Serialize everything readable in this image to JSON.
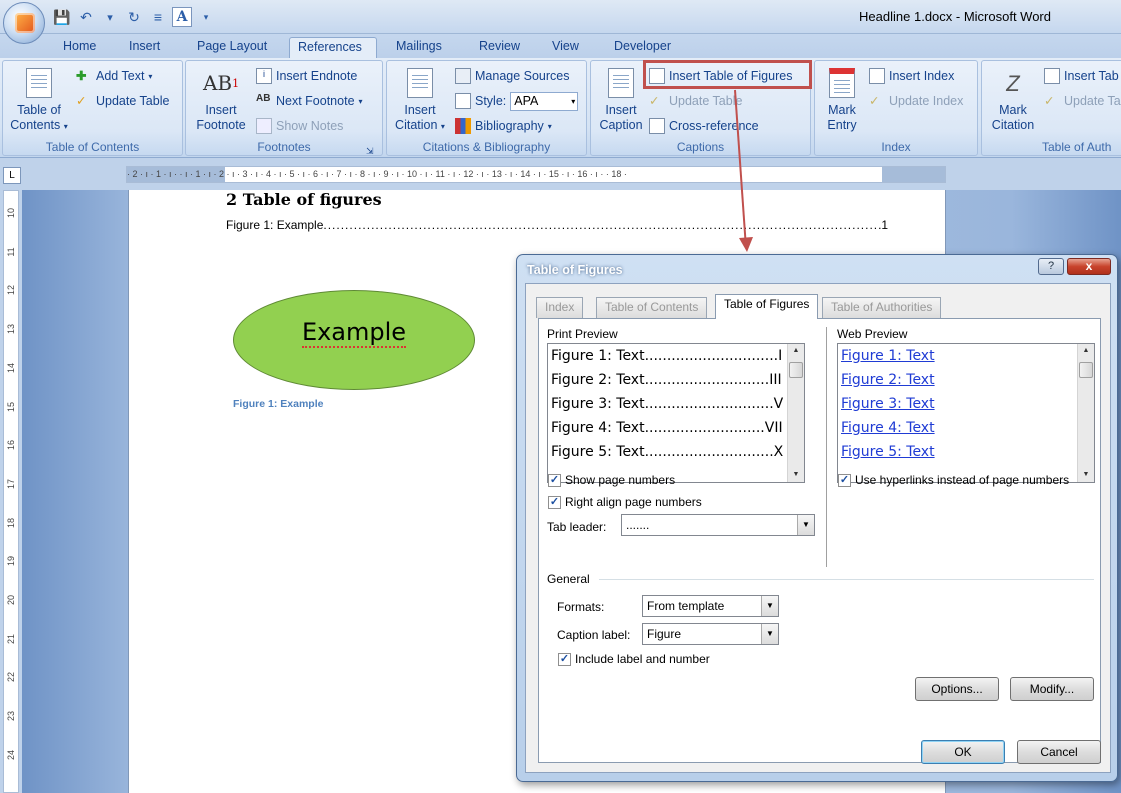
{
  "window": {
    "title": "Headline 1.docx - Microsoft Word"
  },
  "qat": {
    "icons": [
      "save-icon",
      "undo-icon",
      "redo-icon",
      "format-icon",
      "spelling-icon",
      "customize-icon"
    ]
  },
  "tabs": [
    "Home",
    "Insert",
    "Page Layout",
    "References",
    "Mailings",
    "Review",
    "View",
    "Developer"
  ],
  "active_tab": "References",
  "ribbon": {
    "toc": {
      "big_line1": "Table of",
      "big_line2": "Contents",
      "add_text": "Add Text",
      "update_table": "Update Table",
      "label": "Table of Contents"
    },
    "footnotes": {
      "big_line1": "Insert",
      "big_line2": "Footnote",
      "insert_endnote": "Insert Endnote",
      "next_footnote": "Next Footnote",
      "show_notes": "Show Notes",
      "label": "Footnotes",
      "icon_text": "AB"
    },
    "citations": {
      "big_line1": "Insert",
      "big_line2": "Citation",
      "manage_sources": "Manage Sources",
      "style_label": "Style:",
      "style_value": "APA",
      "bibliography": "Bibliography",
      "label": "Citations & Bibliography"
    },
    "captions": {
      "big_line1": "Insert",
      "big_line2": "Caption",
      "insert_tof": "Insert Table of Figures",
      "update_table": "Update Table",
      "cross_reference": "Cross-reference",
      "label": "Captions"
    },
    "index": {
      "big_line1": "Mark",
      "big_line2": "Entry",
      "insert_index": "Insert Index",
      "update_index": "Update Index",
      "label": "Index"
    },
    "authorities": {
      "big_line1": "Mark",
      "big_line2": "Citation",
      "insert_table": "Insert Tab",
      "update_table": "Update Ta",
      "label": "Table of Auth"
    }
  },
  "ruler": {
    "corner": "L",
    "text": "· 2 · ı · 1 · ı ·   · ı · 1 · ı · 2 · ı · 3 · ı · 4 · ı · 5 · ı · 6 · ı · 7 · ı · 8 · ı · 9 · ı · 10 · ı · 11 · ı · 12 · ı · 13 · ı · 14 · ı · 15 · ı · 16 · ı ·   · 18 ·",
    "vertical": [
      "10",
      "11",
      "12",
      "13",
      "14",
      "15",
      "16",
      "17",
      "18",
      "19",
      "20",
      "21",
      "22",
      "23",
      "24"
    ]
  },
  "document": {
    "heading": "2    Table of figures",
    "toc_entry": "Figure 1: Example",
    "toc_dots": "........................................................................................................................................................................................",
    "toc_page": "1",
    "shape_text": "Example",
    "caption": "Figure 1: Example"
  },
  "dialog": {
    "title": "Table of Figures",
    "help": "?",
    "close": "x",
    "tabs": [
      "Index",
      "Table of Contents",
      "Table of Figures",
      "Table of Authorities"
    ],
    "active_tab": "Table of Figures",
    "print_preview_label": "Print Preview",
    "print_preview": [
      "Figure 1: Text..............................I",
      "Figure 2: Text............................III",
      "Figure 3: Text.............................V",
      "Figure 4: Text...........................VII",
      "Figure 5: Text.............................X"
    ],
    "web_preview_label": "Web Preview",
    "web_preview": [
      "Figure 1: Text",
      "Figure 2: Text",
      "Figure 3: Text",
      "Figure 4: Text",
      "Figure 5: Text"
    ],
    "show_page_numbers": "Show page numbers",
    "right_align": "Right align page numbers",
    "tab_leader_label": "Tab leader:",
    "tab_leader_value": ".......",
    "use_hyperlinks": "Use hyperlinks instead of page numbers",
    "general_label": "General",
    "formats_label": "Formats:",
    "formats_value": "From template",
    "caption_label_label": "Caption label:",
    "caption_label_value": "Figure",
    "include_label": "Include label and number",
    "options": "Options...",
    "modify": "Modify...",
    "ok": "OK",
    "cancel": "Cancel"
  },
  "colors": {
    "highlight": "#c0504d",
    "shape_fill": "#92d050",
    "caption": "#4f81bd",
    "link": "#1f3bd4"
  }
}
